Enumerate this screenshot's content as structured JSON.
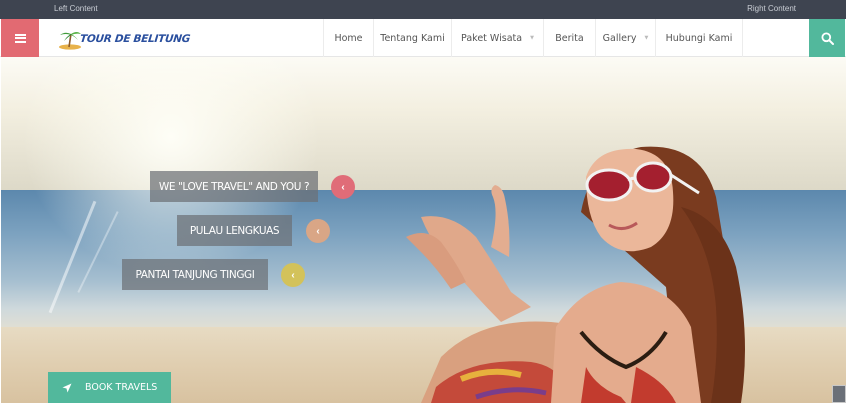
{
  "topbar": {
    "left": "Left Content",
    "right": "Right Content"
  },
  "header": {
    "logo_text": "TOUR DE BELITUNG",
    "menu_icon": "hamburger-icon",
    "search_icon": "search-icon",
    "nav": [
      {
        "label": "Home"
      },
      {
        "label": "Tentang Kami"
      },
      {
        "label": "Paket Wisata",
        "dropdown": true
      },
      {
        "label": "Berita"
      },
      {
        "label": "Gallery",
        "dropdown": true
      },
      {
        "label": "Hubungi Kami"
      }
    ]
  },
  "hero": {
    "slides": [
      {
        "label": "WE \"LOVE TRAVEL\" AND YOU ?",
        "dot_color": "#e06c78",
        "icon": "chevron-left-icon"
      },
      {
        "label": "PULAU LENGKUAS",
        "dot_color": "#d9a686",
        "icon": "chevron-left-icon"
      },
      {
        "label": "PANTAI TANJUNG TINGGI",
        "dot_color": "#d3c25a",
        "icon": "chevron-left-icon"
      }
    ],
    "book_button": {
      "label": "BOOK TRAVELS",
      "icon": "location-arrow-icon"
    }
  },
  "colors": {
    "topbar": "#3e4450",
    "menu_button": "#e26a72",
    "accent": "#52b89c",
    "logo": "#2a4f9e"
  }
}
